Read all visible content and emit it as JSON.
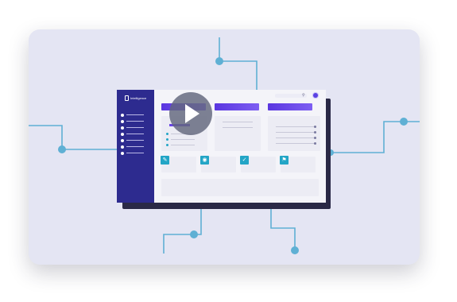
{
  "app": {
    "logo_text": "Intelligence"
  },
  "colors": {
    "card_background": "#e4e5f3",
    "circuit_line": "#5fb0d4",
    "sidebar": "#2d2b8f",
    "header_bar": "#5a36e0",
    "tile_icon": "#23a5c6",
    "play_overlay": "#62667c"
  },
  "icons": {
    "search": "magnifier-icon",
    "tiles": [
      "edit-icon",
      "eye-icon",
      "check-icon",
      "flag-icon"
    ],
    "play": "play-icon"
  },
  "glyphs": {
    "search": "⚲",
    "tiles": [
      "✎",
      "◉",
      "✓",
      "⚑"
    ]
  }
}
